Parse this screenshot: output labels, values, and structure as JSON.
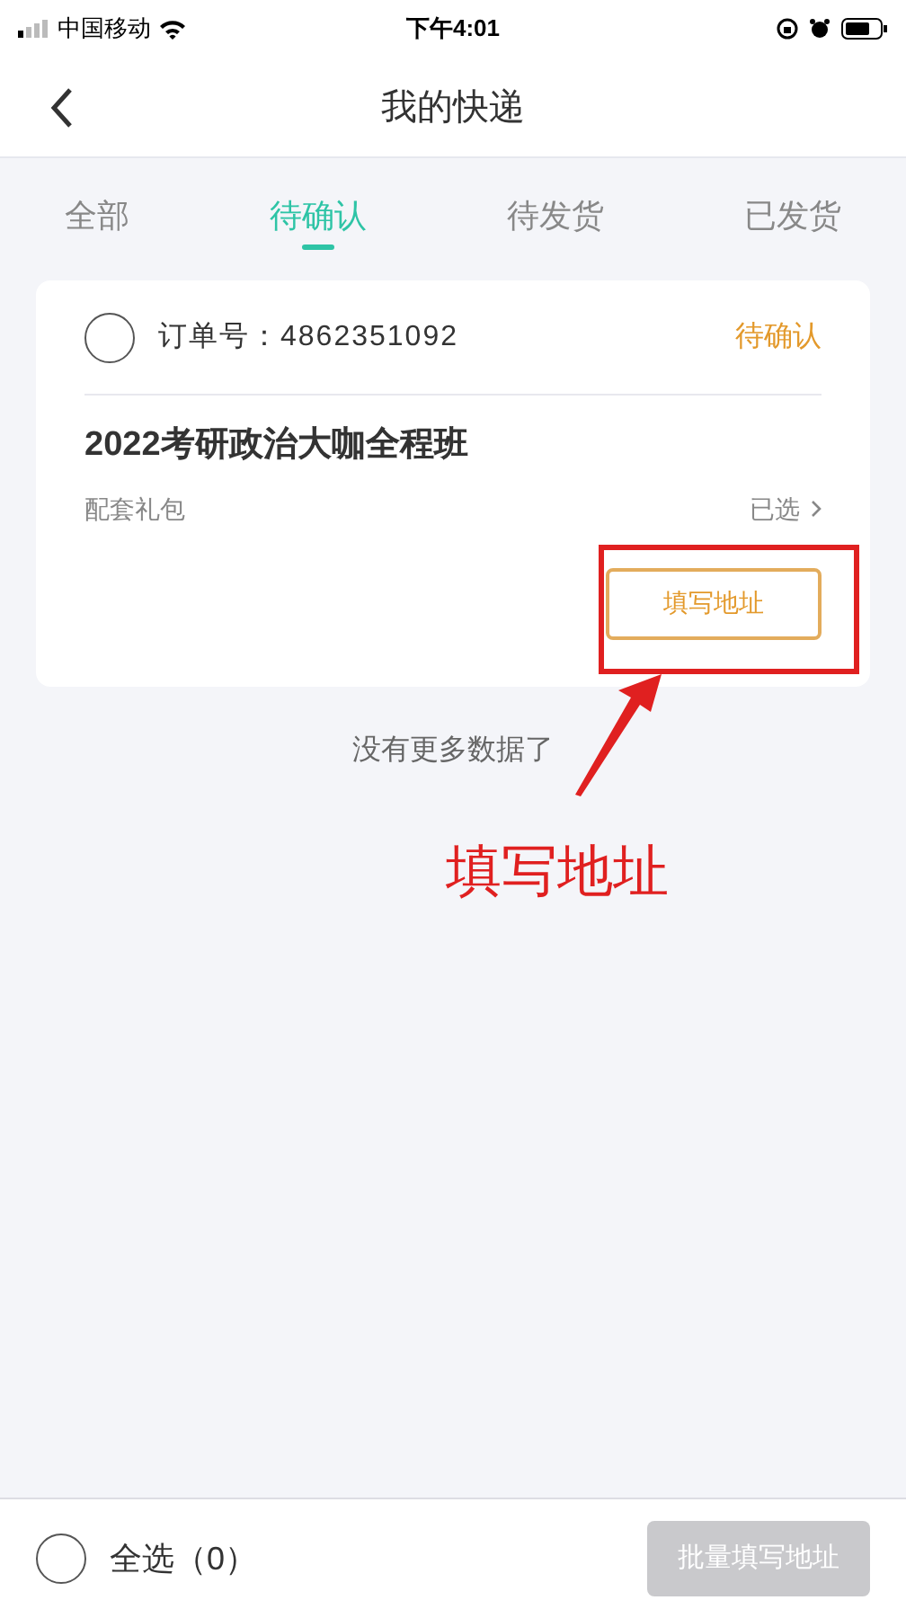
{
  "status_bar": {
    "carrier": "中国移动",
    "time": "下午4:01"
  },
  "nav": {
    "title": "我的快递"
  },
  "tabs": [
    {
      "label": "全部",
      "selected": false
    },
    {
      "label": "待确认",
      "selected": true
    },
    {
      "label": "待发货",
      "selected": false
    },
    {
      "label": "已发货",
      "selected": false
    }
  ],
  "orders": [
    {
      "checked": false,
      "order_no": "订单号：4862351092",
      "status": "待确认",
      "title": "2022考研政治大咖全程班",
      "gift_label": "配套礼包",
      "gift_value": "已选",
      "action": "填写地址"
    }
  ],
  "end_text": "没有更多数据了",
  "bottom_bar": {
    "select_all": {
      "checked": false,
      "label": "全选（0）"
    },
    "batch_button": {
      "label": "批量填写地址",
      "disabled": true
    }
  },
  "annotation": {
    "text": "填写地址"
  }
}
